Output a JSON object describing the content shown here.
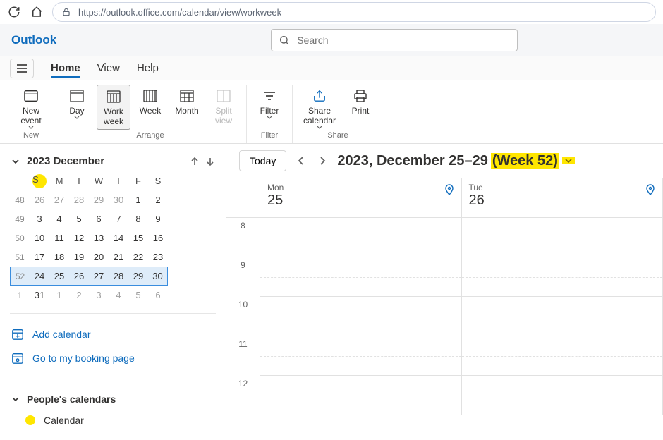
{
  "browser": {
    "url": "https://outlook.office.com/calendar/view/workweek"
  },
  "app": {
    "brand": "Outlook",
    "search_placeholder": "Search"
  },
  "tabs": {
    "home": "Home",
    "view": "View",
    "help": "Help"
  },
  "ribbon": {
    "new_event": "New event",
    "day": "Day",
    "work_week": "Work week",
    "week": "Week",
    "month": "Month",
    "split_view": "Split view",
    "filter": "Filter",
    "share_calendar": "Share calendar",
    "print": "Print",
    "group_new": "New",
    "group_arrange": "Arrange",
    "group_filter": "Filter",
    "group_share": "Share"
  },
  "miniCal": {
    "title": "2023 December",
    "dayHeaders": [
      "S",
      "M",
      "T",
      "W",
      "T",
      "F",
      "S"
    ],
    "rows": [
      {
        "wk": "48",
        "days": [
          "26",
          "27",
          "28",
          "29",
          "30",
          "1",
          "2"
        ],
        "dim": [
          0,
          1,
          2,
          3,
          4
        ]
      },
      {
        "wk": "49",
        "days": [
          "3",
          "4",
          "5",
          "6",
          "7",
          "8",
          "9"
        ]
      },
      {
        "wk": "50",
        "days": [
          "10",
          "11",
          "12",
          "13",
          "14",
          "15",
          "16"
        ]
      },
      {
        "wk": "51",
        "days": [
          "17",
          "18",
          "19",
          "20",
          "21",
          "22",
          "23"
        ]
      },
      {
        "wk": "52",
        "days": [
          "24",
          "25",
          "26",
          "27",
          "28",
          "29",
          "30"
        ],
        "selected": true
      },
      {
        "wk": "1",
        "days": [
          "31",
          "1",
          "2",
          "3",
          "4",
          "5",
          "6"
        ],
        "dim": [
          1,
          2,
          3,
          4,
          5,
          6
        ]
      }
    ]
  },
  "sidebar": {
    "add_calendar": "Add calendar",
    "booking": "Go to my booking page",
    "peoples_calendars": "People's calendars",
    "calendar_item": "Calendar"
  },
  "content": {
    "today": "Today",
    "range_main": "2023, December 25–29",
    "range_week": "(Week 52)",
    "days": [
      {
        "name": "Mon",
        "num": "25"
      },
      {
        "name": "Tue",
        "num": "26"
      }
    ],
    "hours": [
      "8",
      "9",
      "10",
      "11",
      "12"
    ]
  }
}
